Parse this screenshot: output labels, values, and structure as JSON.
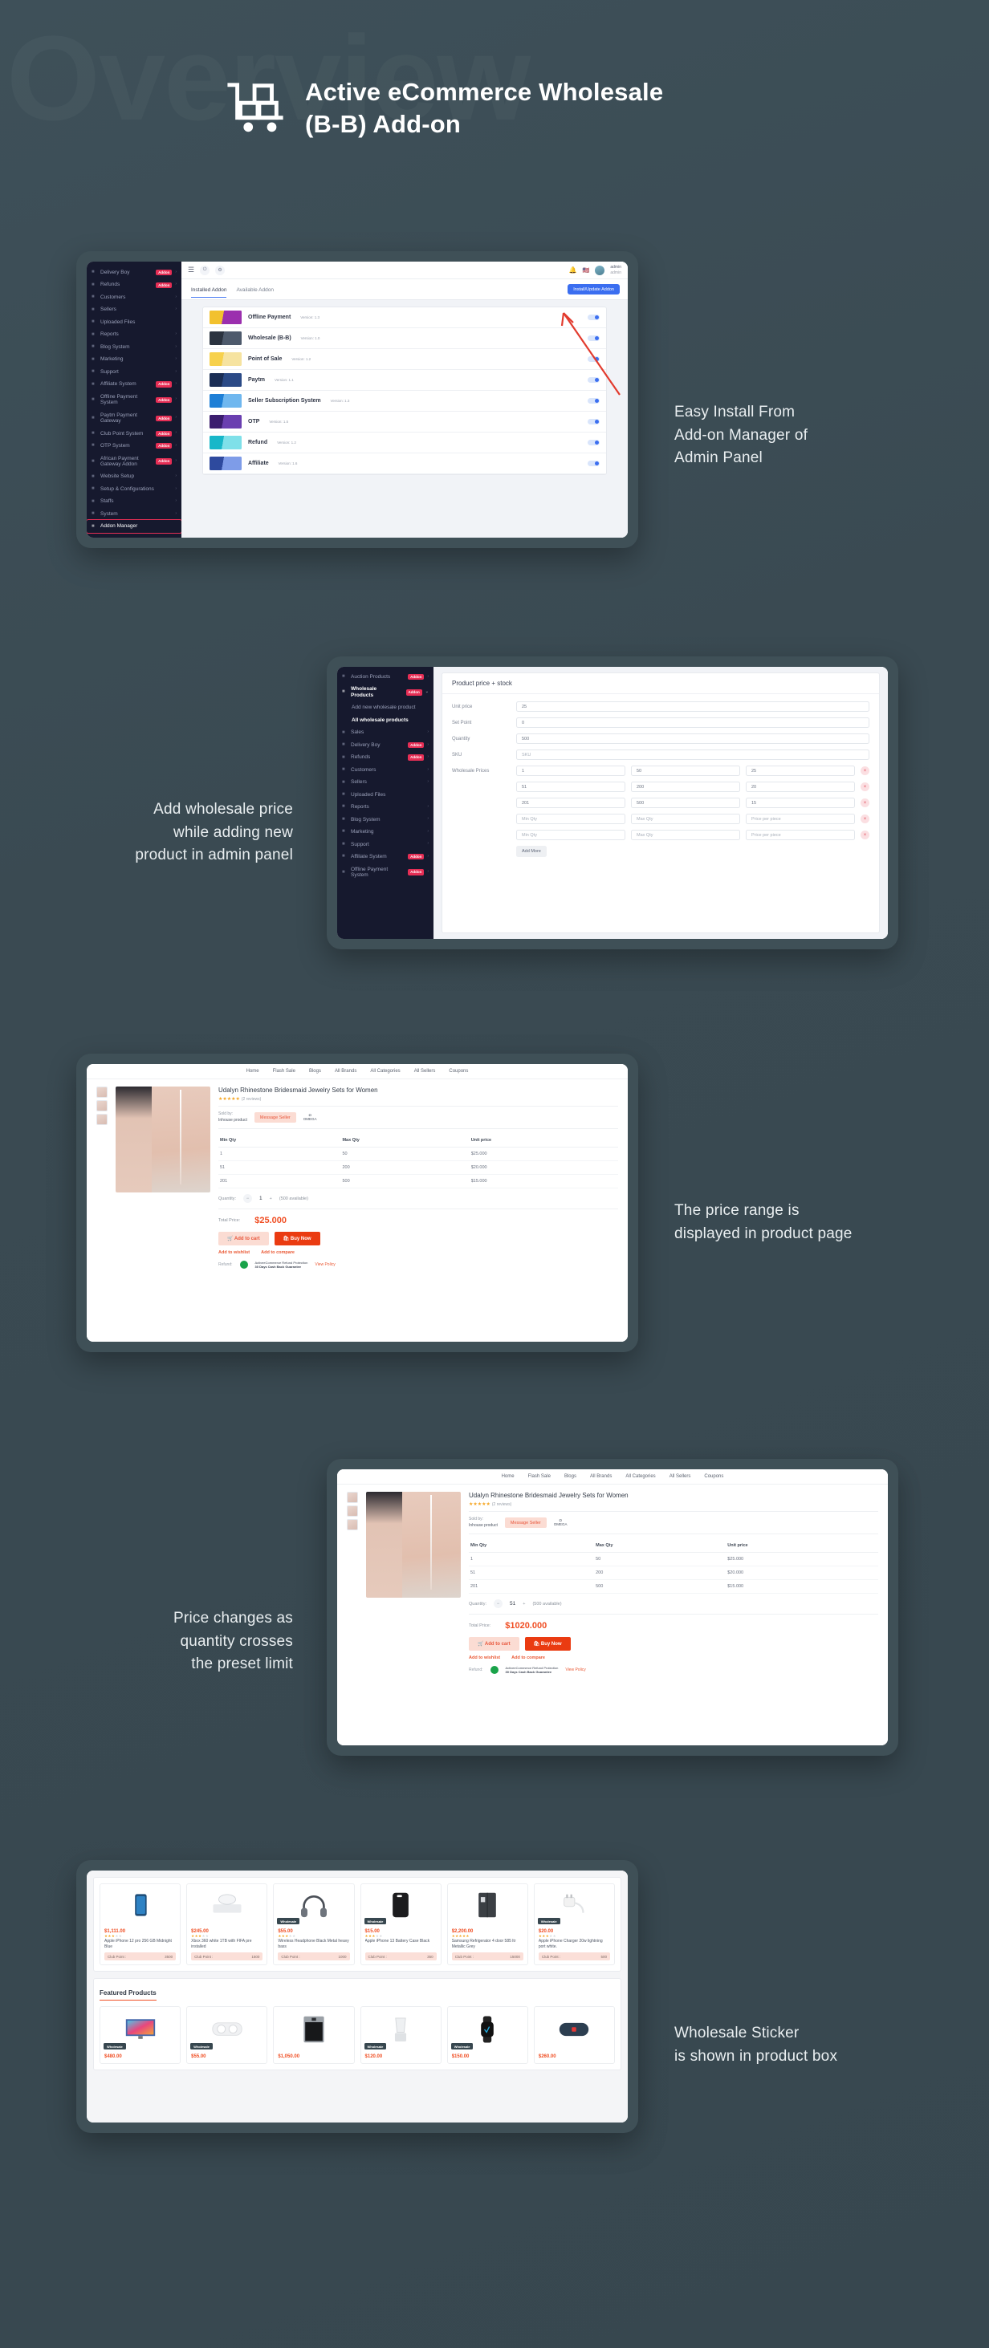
{
  "header": {
    "ghost_word": "Overview",
    "title": "Active eCommerce Wholesale\n(B-B) Add-on",
    "logo_icon": "wholesale-cart-boxes-icon"
  },
  "panel1": {
    "caption": "Easy Install From\nAdd-on Manager of\nAdmin Panel",
    "sidebar": [
      {
        "label": "Delivery Boy",
        "badge": "Addon",
        "caret": "›",
        "icon": "truck-icon"
      },
      {
        "label": "Refunds",
        "badge": "Addon",
        "caret": "›",
        "icon": "refund-icon"
      },
      {
        "label": "Customers",
        "badge": "",
        "caret": "›",
        "icon": "users-icon"
      },
      {
        "label": "Sellers",
        "badge": "",
        "caret": "›",
        "icon": "seller-icon"
      },
      {
        "label": "Uploaded Files",
        "badge": "",
        "caret": "",
        "icon": "files-icon"
      },
      {
        "label": "Reports",
        "badge": "",
        "caret": "›",
        "icon": "report-icon"
      },
      {
        "label": "Blog System",
        "badge": "",
        "caret": "›",
        "icon": "blog-icon"
      },
      {
        "label": "Marketing",
        "badge": "",
        "caret": "›",
        "icon": "marketing-icon"
      },
      {
        "label": "Support",
        "badge": "",
        "caret": "›",
        "icon": "support-icon"
      },
      {
        "label": "Affiliate System",
        "badge": "Addon",
        "caret": "›",
        "icon": "affiliate-icon"
      },
      {
        "label": "Offline Payment\nSystem",
        "badge": "Addon",
        "caret": "›",
        "icon": "payment-icon"
      },
      {
        "label": "Paytm Payment\nGateway",
        "badge": "Addon",
        "caret": "›",
        "icon": "paytm-icon"
      },
      {
        "label": "Club Point System",
        "badge": "Addon",
        "caret": "›",
        "icon": "club-point-icon"
      },
      {
        "label": "OTP System",
        "badge": "Addon",
        "caret": "›",
        "icon": "otp-icon"
      },
      {
        "label": "African Payment\nGateway Addon",
        "badge": "Addon",
        "caret": "›",
        "icon": "african-payment-icon"
      },
      {
        "label": "Website Setup",
        "badge": "",
        "caret": "›",
        "icon": "website-icon"
      },
      {
        "label": "Setup & Configurations",
        "badge": "",
        "caret": "›",
        "icon": "gear-icon"
      },
      {
        "label": "Staffs",
        "badge": "",
        "caret": "›",
        "icon": "staff-icon"
      },
      {
        "label": "System",
        "badge": "",
        "caret": "›",
        "icon": "system-icon"
      },
      {
        "label": "Addon Manager",
        "badge": "",
        "caret": "",
        "icon": "addon-manager-icon",
        "highlight": true
      }
    ],
    "topbar": {
      "user_name": "admin",
      "user_role": "admin",
      "menu_icon": "hamburger-icon",
      "bell_icon": "bell-icon",
      "flag_icon": "flag-icon"
    },
    "tabs": [
      {
        "label": "Installed Addon",
        "active": true
      },
      {
        "label": "Available Addon",
        "active": false
      }
    ],
    "install_button": "Install/Update Addon",
    "addons": [
      {
        "name": "Offline Payment",
        "version": "Version: 1.3",
        "c1": "#f2c12e",
        "c2": "#9b2fae"
      },
      {
        "name": "Wholesale (B-B)",
        "version": "Version: 1.0",
        "c1": "#2b3340",
        "c2": "#4e5a6c"
      },
      {
        "name": "Point of Sale",
        "version": "Version: 1.2",
        "c1": "#f7d14c",
        "c2": "#f6e3a0"
      },
      {
        "name": "Paytm",
        "version": "Version: 1.1",
        "c1": "#1b2e55",
        "c2": "#2b4a86"
      },
      {
        "name": "Seller Subscription System",
        "version": "Version: 1.3",
        "c1": "#1e7fd6",
        "c2": "#6fb7ef"
      },
      {
        "name": "OTP",
        "version": "Version: 1.5",
        "c1": "#3b1d6e",
        "c2": "#6a3fb0"
      },
      {
        "name": "Refund",
        "version": "Version: 1.2",
        "c1": "#18b7c9",
        "c2": "#7fe0e9"
      },
      {
        "name": "Affiliate",
        "version": "Version: 1.6",
        "c1": "#2e4a9e",
        "c2": "#7e9ce8"
      }
    ]
  },
  "panel2": {
    "caption": "Add wholesale price\nwhile adding new\nproduct in admin panel",
    "sidebar": [
      {
        "label": "Auction Products",
        "badge": "Addon",
        "caret": "›"
      },
      {
        "label": "Wholesale\nProducts",
        "badge": "Addon",
        "caret": "⌄",
        "sel": true
      },
      {
        "label": "Add new wholesale product",
        "sub": true
      },
      {
        "label": "All wholesale products",
        "sub": true,
        "sel": true
      },
      {
        "label": "Sales",
        "badge": "",
        "caret": "›"
      },
      {
        "label": "Delivery Boy",
        "badge": "Addon",
        "caret": "›"
      },
      {
        "label": "Refunds",
        "badge": "Addon",
        "caret": "›"
      },
      {
        "label": "Customers",
        "badge": "",
        "caret": "›"
      },
      {
        "label": "Sellers",
        "badge": "",
        "caret": "›"
      },
      {
        "label": "Uploaded Files",
        "badge": "",
        "caret": ""
      },
      {
        "label": "Reports",
        "badge": "",
        "caret": "›"
      },
      {
        "label": "Blog System",
        "badge": "",
        "caret": "›"
      },
      {
        "label": "Marketing",
        "badge": "",
        "caret": "›"
      },
      {
        "label": "Support",
        "badge": "",
        "caret": "›"
      },
      {
        "label": "Affiliate System",
        "badge": "Addon",
        "caret": "›"
      },
      {
        "label": "Offline Payment\nSystem",
        "badge": "Addon",
        "caret": "›"
      }
    ],
    "card_title": "Product price + stock",
    "fields": [
      {
        "label": "Unit price",
        "value": "25"
      },
      {
        "label": "Set Point",
        "value": "0"
      },
      {
        "label": "Quantity",
        "value": "500"
      },
      {
        "label": "SKU",
        "value": "SKU",
        "placeholder": true
      }
    ],
    "wholesale_label": "Wholesale Prices",
    "wholesale_rows": [
      {
        "min": "1",
        "max": "50",
        "price": "25",
        "placeholder": false
      },
      {
        "min": "51",
        "max": "200",
        "price": "20",
        "placeholder": false
      },
      {
        "min": "201",
        "max": "500",
        "price": "15",
        "placeholder": false
      },
      {
        "min": "Min Qty",
        "max": "Max Qty",
        "price": "Price per piece",
        "placeholder": true
      },
      {
        "min": "Min Qty",
        "max": "Max Qty",
        "price": "Price per piece",
        "placeholder": true
      }
    ],
    "add_more": "Add More",
    "delete_icon": "remove-row-icon"
  },
  "panel3": {
    "caption": "The price range is\ndisplayed in product page",
    "nav": [
      "Home",
      "Flash Sale",
      "Blogs",
      "All Brands",
      "All Categories",
      "All Sellers",
      "Coupons"
    ],
    "product_title": "Udalyn Rhinestone Bridesmaid Jewelry Sets for Women",
    "stars": "★★★★★",
    "reviews": "(2 reviews)",
    "sold_by_label": "Sold by:",
    "sold_by_value": "Inhouse product",
    "message_seller": "Message Seller",
    "brand": "OMEGA",
    "table_headers": [
      "Min Qty",
      "Max Qty",
      "Unit price"
    ],
    "table_rows": [
      [
        "1",
        "50",
        "$25.000"
      ],
      [
        "51",
        "200",
        "$20.000"
      ],
      [
        "201",
        "500",
        "$15.000"
      ]
    ],
    "quantity_label": "Quantity:",
    "quantity_value": "1",
    "available": "(500 available)",
    "total_label": "Total Price:",
    "total_value": "$25.000",
    "add_to_cart": "Add to cart",
    "buy_now": "Buy Now",
    "wishlist": "Add to wishlist",
    "compare": "Add to compare",
    "refund_label": "Refund:",
    "guarantee_title": "ActiveeCommerce Refund Protection",
    "guarantee_text": "30 Days Cash Back Guarantee",
    "view_policy": "View Policy"
  },
  "panel4": {
    "caption": "Price changes as\nquantity crosses\nthe preset limit",
    "quantity_value": "51",
    "total_value": "$1020.000"
  },
  "panel5": {
    "caption": "Wholesale Sticker\nis shown in product box",
    "sticker_label": "Wholesale",
    "club_point_label": "Club Point :",
    "featured_title": "Featured Products",
    "row1": [
      {
        "price": "$1,111.00",
        "stars": 3,
        "name": "Apple iPhone 12 pro 256 GB Midnight Blue",
        "club": "3500",
        "sticker": false,
        "icon": "phone-icon"
      },
      {
        "price": "$245.00",
        "stars": 3,
        "name": "Xbox 360 white 1TB with FIFA pre installed",
        "club": "1500",
        "sticker": false,
        "icon": "console-icon"
      },
      {
        "price": "$55.00",
        "stars": 3,
        "name": "Wireless Headphone Black Metal heavy bass",
        "club": "1000",
        "sticker": true,
        "icon": "headphone-icon"
      },
      {
        "price": "$15.00",
        "stars": 3,
        "name": "Apple iPhone 13 Battery Case Black",
        "club": "350",
        "sticker": true,
        "icon": "case-icon"
      },
      {
        "price": "$2,200.00",
        "stars": 5,
        "name": "Samsung Refrigerator 4 door 585 ltr Metallic Grey",
        "club": "15000",
        "sticker": false,
        "icon": "fridge-icon"
      },
      {
        "price": "$20.00",
        "stars": 3,
        "name": "Apple iPhone Charger 20w lightning port white.",
        "club": "500",
        "sticker": true,
        "icon": "charger-icon"
      }
    ],
    "row2": [
      {
        "price": "$480.00",
        "sticker": true,
        "icon": "tv-icon"
      },
      {
        "price": "$55.00",
        "sticker": true,
        "icon": "magsafe-icon"
      },
      {
        "price": "$1,050.00",
        "sticker": false,
        "icon": "oven-icon"
      },
      {
        "price": "$120.00",
        "sticker": true,
        "icon": "blender-icon"
      },
      {
        "price": "$150.00",
        "sticker": true,
        "icon": "smartwatch-icon"
      },
      {
        "price": "$260.00",
        "sticker": false,
        "icon": "speaker-icon"
      }
    ]
  },
  "colors": {
    "background": "#3a4a52",
    "accent_red": "#e62e55",
    "price_orange": "#f04e23",
    "sidebar_dark": "#16192e",
    "button_blue": "#3b6ef0"
  }
}
